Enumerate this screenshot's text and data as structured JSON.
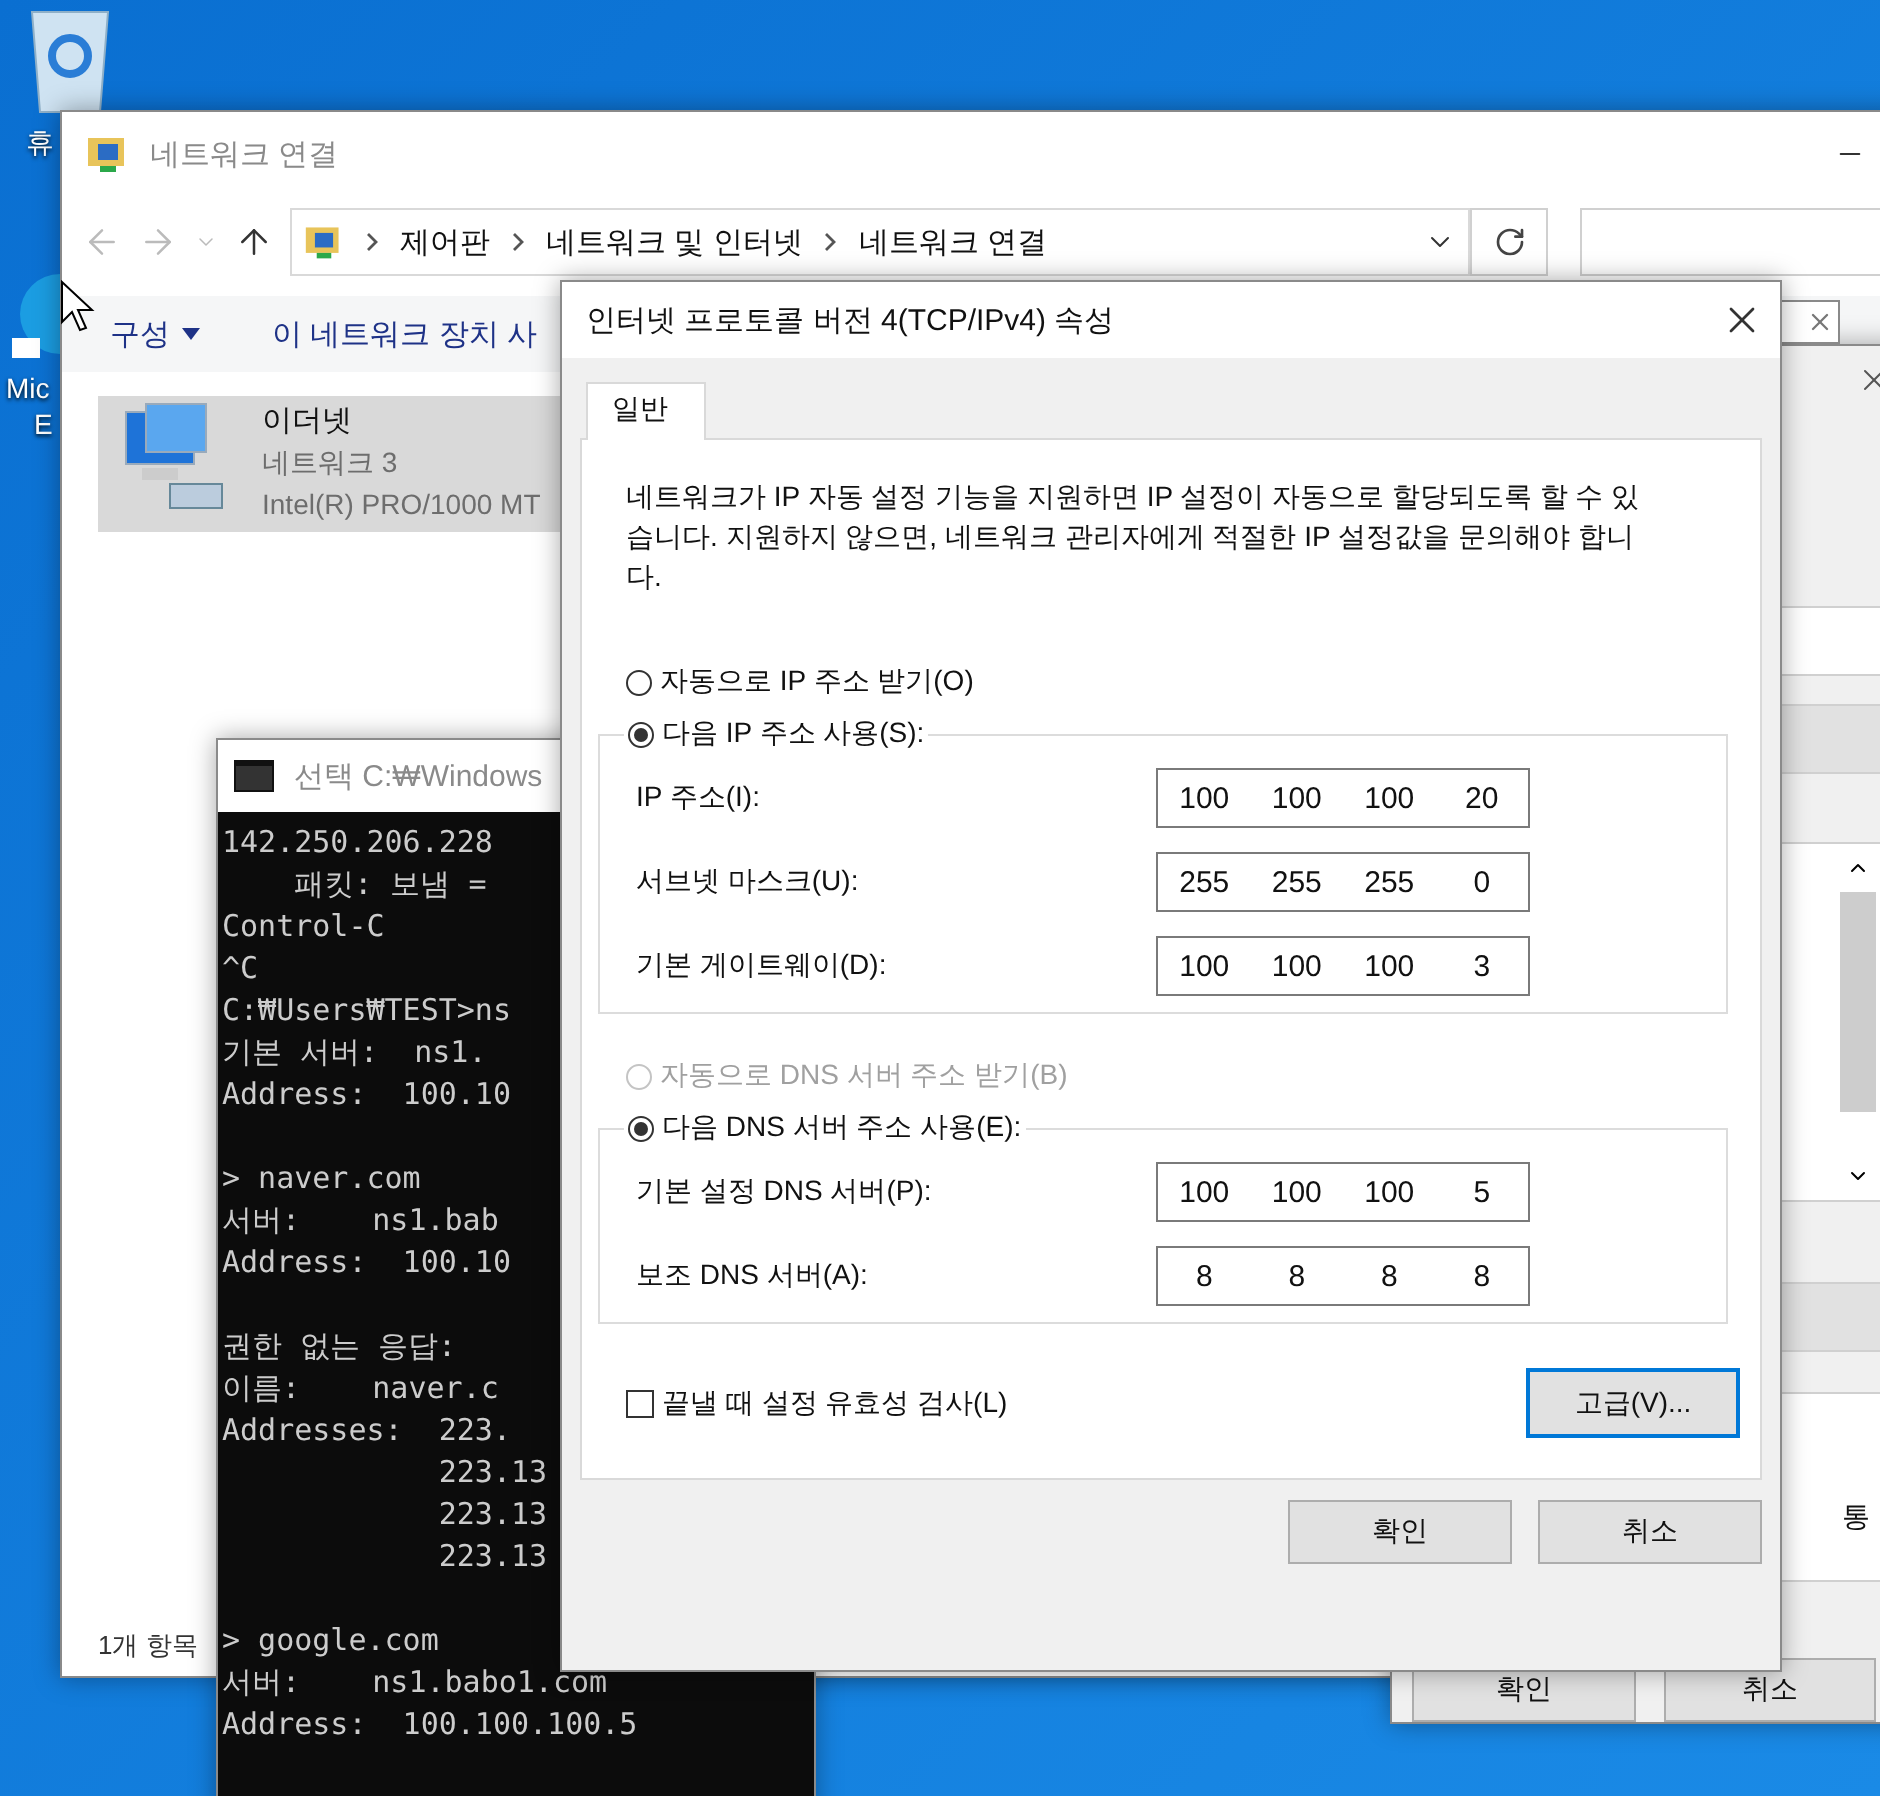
{
  "desktop": {
    "icons": [
      {
        "kind": "recycle",
        "label": "휴"
      },
      {
        "kind": "browser",
        "label": "Mic",
        "label_2": "E"
      }
    ]
  },
  "explorer": {
    "title": "네트워크 연결",
    "breadcrumb": [
      "제어판",
      "네트워크 및 인터넷",
      "네트워크 연결"
    ],
    "toolbar": [
      "구성",
      "이 네트워크 장치 사"
    ],
    "items": [
      {
        "name": "이더넷",
        "network": "네트워크 3",
        "adapter": "Intel(R) PRO/1000 MT",
        "selected": true
      }
    ],
    "status_bar": "1개 항목"
  },
  "properties_window": {
    "side_text": "통",
    "buttons": [
      "확인",
      "취소"
    ]
  },
  "console": {
    "title": "선택 C:₩Windows",
    "blocks": [
      [
        "142.250.206.228",
        "    패킷: 보냄 =",
        "Control-C",
        "^C",
        "C:₩Users₩TEST>ns",
        "기본 서버:  ns1.",
        "Address:  100.10"
      ],
      [
        "> naver.com",
        "서버:    ns1.bab",
        "Address:  100.10"
      ],
      [
        "권한 없는 응답:",
        "이름:    naver.c",
        "Addresses:  223.",
        "            223.13",
        "            223.13",
        "            223.13"
      ],
      [
        "> google.com",
        "서버:    ns1.babo1.com",
        "Address:  100.100.100.5"
      ]
    ]
  },
  "dialog": {
    "title": "인터넷 프로토콜 버전 4(TCP/IPv4) 속성",
    "tabs": [
      {
        "label": "일반",
        "selected": true
      }
    ],
    "description": "네트워크가 IP 자동 설정 기능을 지원하면 IP 설정이 자동으로 할당되도록 할 수 있습니다. 지원하지 않으면, 네트워크 관리자에게 적절한 IP 설정값을 문의해야 합니다.",
    "ip_auto": {
      "label": "자동으로 IP 주소 받기(O)",
      "selected": false,
      "disabled": false
    },
    "ip_manual": {
      "label": "다음 IP 주소 사용(S):",
      "selected": true,
      "disabled": false,
      "fields": [
        {
          "label": "IP 주소(I):",
          "octets": [
            "100",
            "100",
            "100",
            "20"
          ]
        },
        {
          "label": "서브넷 마스크(U):",
          "octets": [
            "255",
            "255",
            "255",
            "0"
          ]
        },
        {
          "label": "기본 게이트웨이(D):",
          "octets": [
            "100",
            "100",
            "100",
            "3"
          ]
        }
      ]
    },
    "dns_auto": {
      "label": "자동으로 DNS 서버 주소 받기(B)",
      "selected": false,
      "disabled": true
    },
    "dns_manual": {
      "label": "다음 DNS 서버 주소 사용(E):",
      "selected": true,
      "disabled": false,
      "fields": [
        {
          "label": "기본 설정 DNS 서버(P):",
          "octets": [
            "100",
            "100",
            "100",
            "5"
          ]
        },
        {
          "label": "보조 DNS 서버(A):",
          "octets": [
            "8",
            "8",
            "8",
            "8"
          ]
        }
      ]
    },
    "validate": {
      "label": "끝낼 때 설정 유효성 검사(L)",
      "checked": false
    },
    "advanced_button": "고급(V)...",
    "buttons": [
      "확인",
      "취소"
    ]
  }
}
